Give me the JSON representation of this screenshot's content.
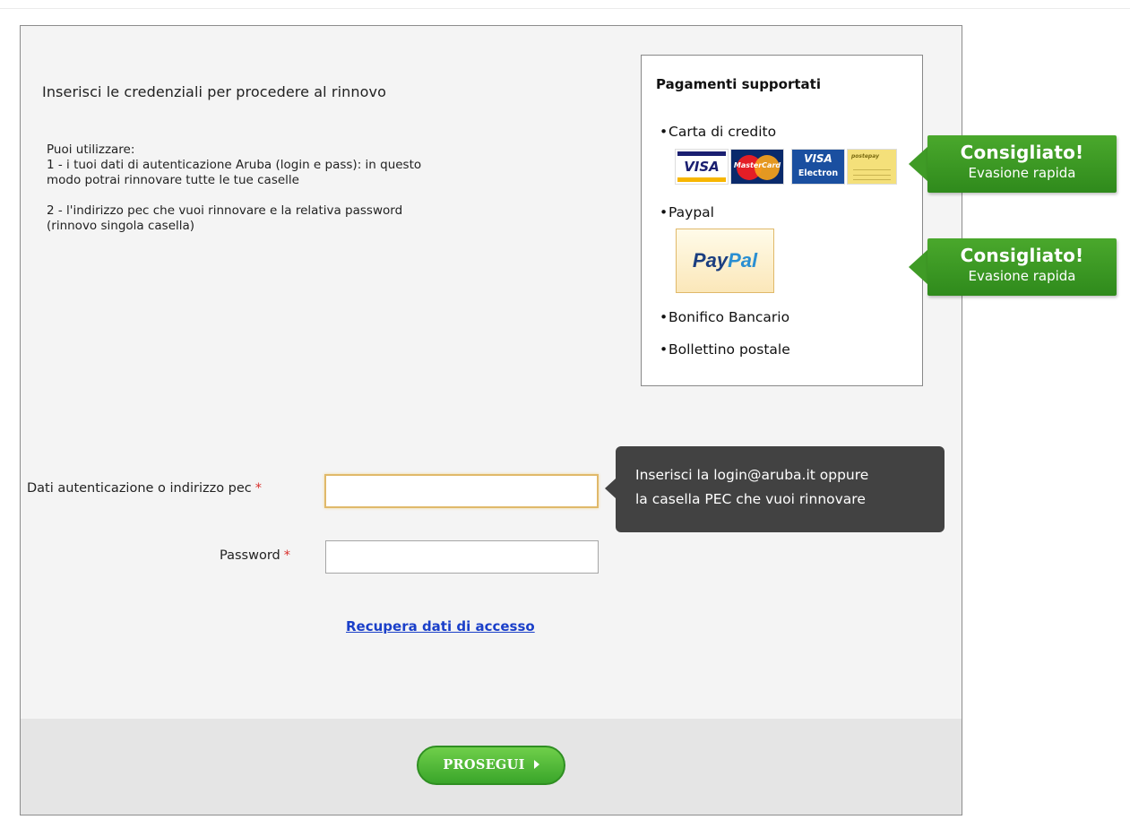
{
  "heading": "Inserisci le credenziali per procedere al rinnovo",
  "intro": {
    "line1": "Puoi utilizzare:",
    "line2": "1 - i tuoi dati di autenticazione Aruba (login e pass): in questo",
    "line3": "modo potrai rinnovare tutte le tue caselle",
    "line4": "2 - l'indirizzo pec che vuoi rinnovare e la relativa password",
    "line5": "(rinnovo singola casella)"
  },
  "payments": {
    "title": "Pagamenti supportati",
    "bullet": "•",
    "items": [
      "Carta di credito",
      "Paypal",
      "Bonifico Bancario",
      "Bollettino postale"
    ],
    "card_logos": {
      "visa": "VISA",
      "mastercard": "MasterCard",
      "electron_top": "VISA",
      "electron_bottom": "Electron",
      "postepay": "postepay"
    },
    "paypal_logo": {
      "part1": "Pay",
      "part2": "Pal"
    }
  },
  "badges": [
    {
      "title": "Consigliato!",
      "subtitle": "Evasione rapida"
    },
    {
      "title": "Consigliato!",
      "subtitle": "Evasione rapida"
    }
  ],
  "form": {
    "login_label": "Dati autenticazione o indirizzo pec",
    "password_label": "Password",
    "required_mark": "*",
    "login_value": "",
    "password_value": ""
  },
  "tooltip": {
    "line1": "Inserisci la login@aruba.it oppure",
    "line2": "la casella PEC che vuoi rinnovare"
  },
  "recover_link": "Recupera dati di accesso",
  "submit_label": "PROSEGUI",
  "colors": {
    "badge_green": "#3f9b26",
    "link_blue": "#1a3fc9",
    "required_red": "#d9302c",
    "tooltip_bg": "#424242"
  }
}
